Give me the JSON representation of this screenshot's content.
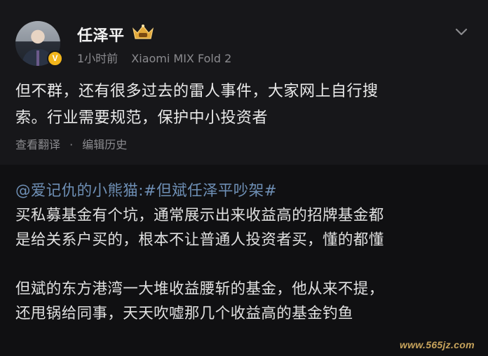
{
  "post": {
    "username": "任泽平",
    "verified_badge": "V",
    "time": "1小时前",
    "device": "Xiaomi MIX Fold 2",
    "text_line1": "但不群，还有很多过去的雷人事件，大家网上自行搜",
    "text_line2": "索。行业需要规范，保护中小投资者",
    "translate_label": "查看翻译",
    "separator": "·",
    "edit_history_label": "编辑历史",
    "crown_icon": "crown-badge-icon",
    "more_icon": "chevron-down-icon",
    "colors": {
      "background": "#17171a",
      "text": "#eaeaea",
      "meta": "#8b8b8f",
      "badge": "#f2b51b"
    }
  },
  "repost": {
    "mention": "@爱记仇的小熊猫:",
    "topic": "#但斌任泽平吵架#",
    "para1_line1": "买私募基金有个坑，通常展示出来收益高的招牌基金都",
    "para1_line2": "是给关系户买的，根本不让普通人投资者买，懂的都懂",
    "para2_line1": "但斌的东方港湾一大堆收益腰斩的基金，他从来不提，",
    "para2_line2": "还甩锅给同事，天天吹嘘那几个收益高的基金钓鱼",
    "colors": {
      "background": "#101012",
      "link": "#6e8fb5"
    }
  },
  "watermark": "www.565jz.com"
}
